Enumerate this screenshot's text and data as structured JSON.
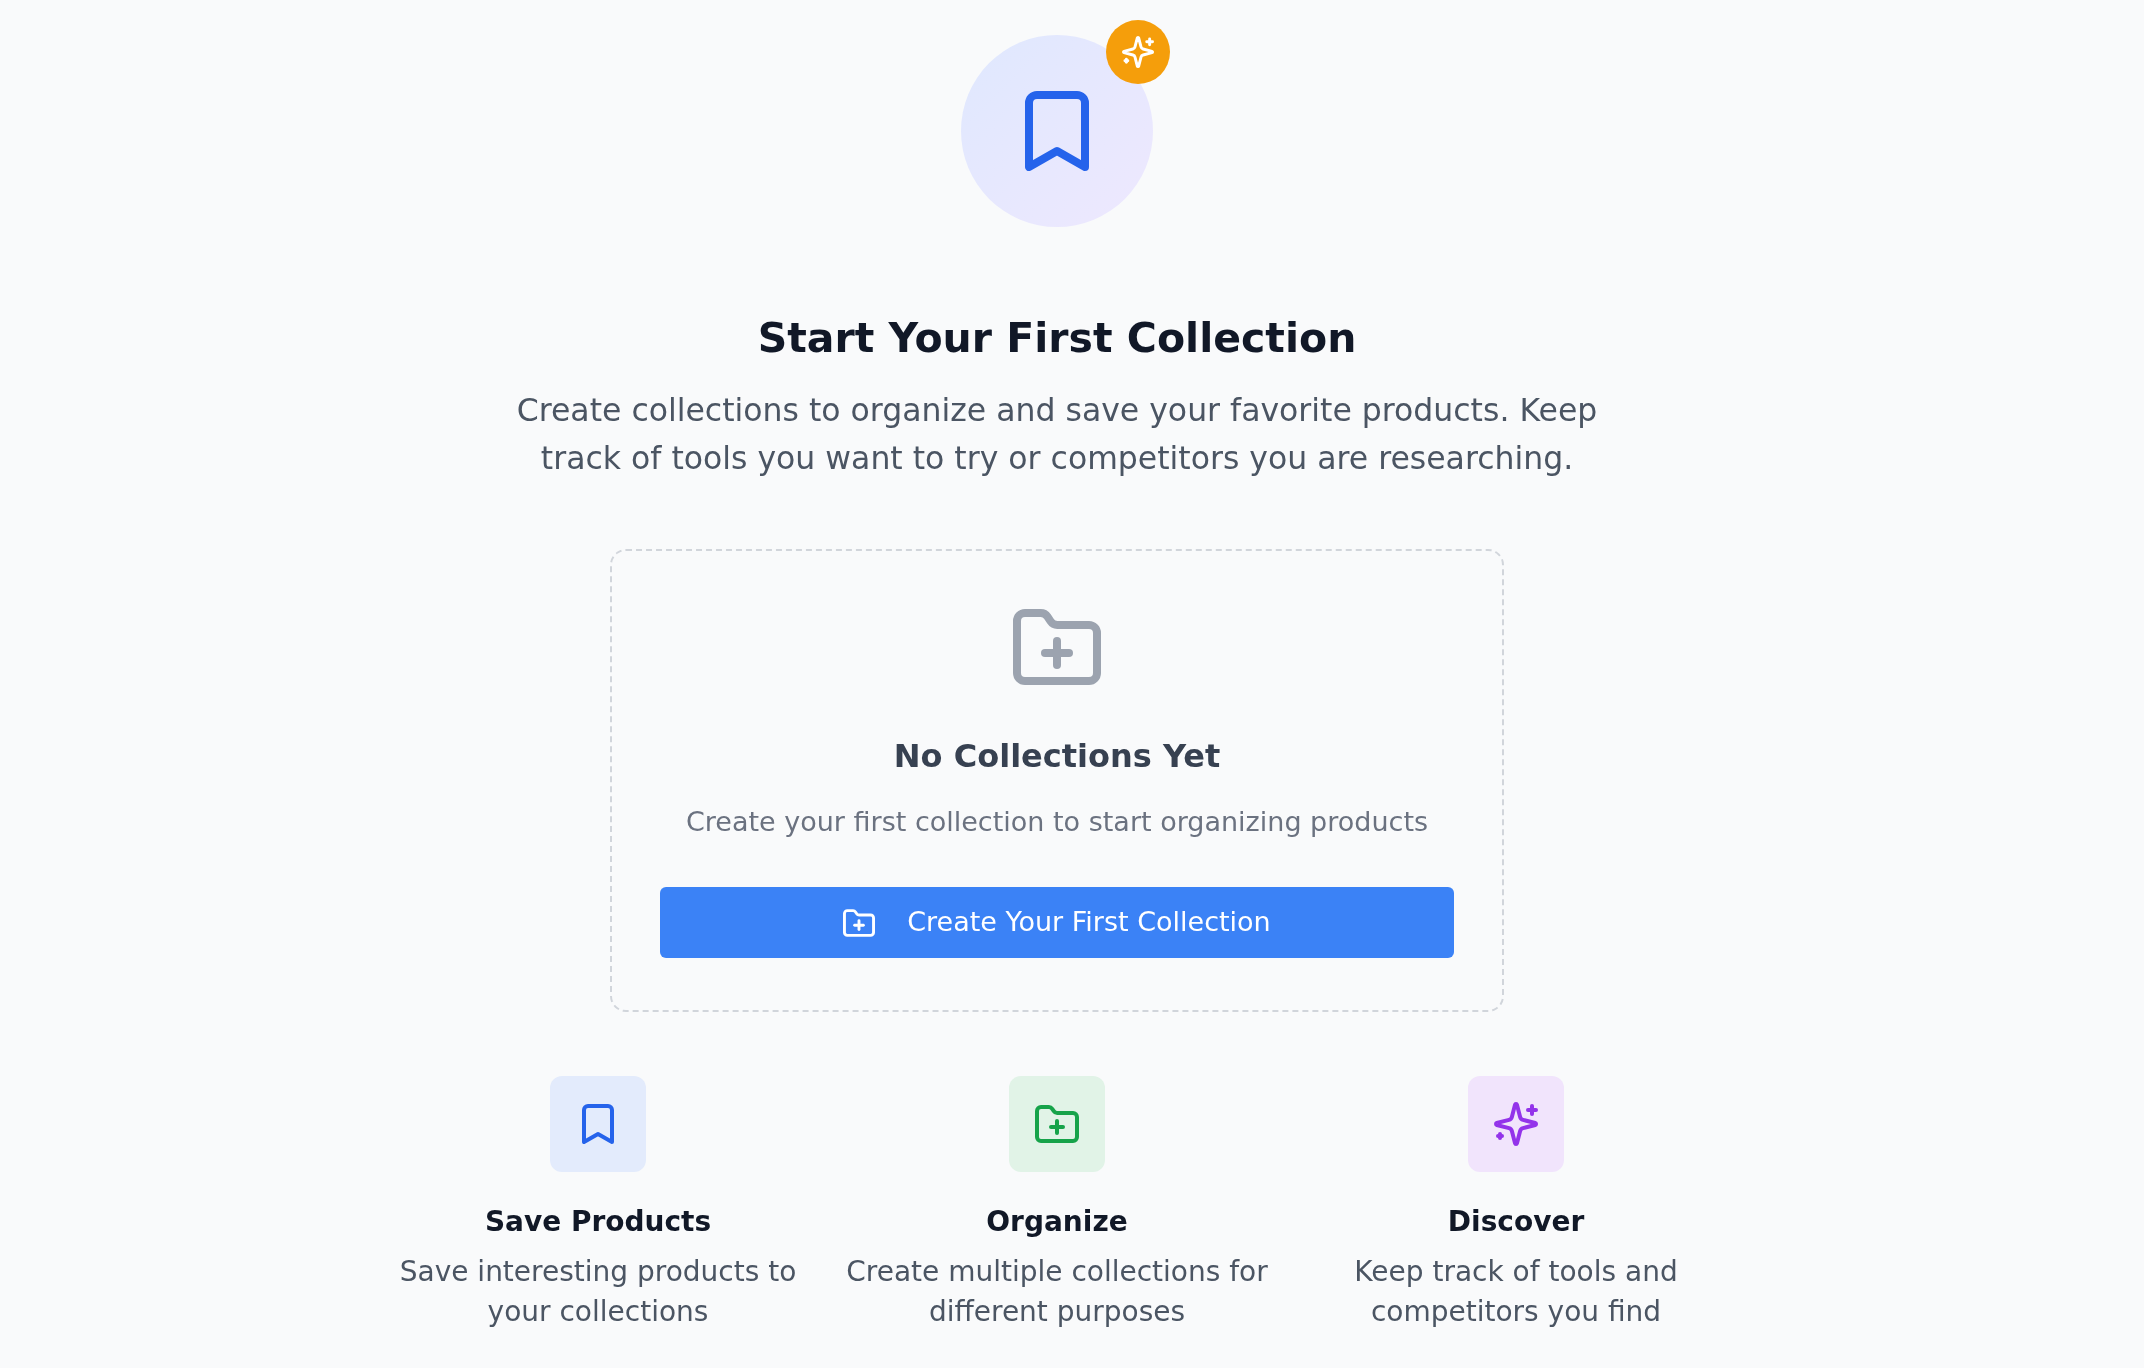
{
  "heading": "Start Your First Collection",
  "intro": "Create collections to organize and save your favorite products. Keep track of tools you want to try or competitors you are researching.",
  "empty_state": {
    "title": "No Collections Yet",
    "message": "Create your first collection to start organizing products",
    "button": "Create Your First Collection"
  },
  "features": [
    {
      "title": "Save Products",
      "description": "Save interesting products to your collections",
      "color": "#2563eb"
    },
    {
      "title": "Organize",
      "description": "Create multiple collections for different purposes",
      "color": "#16a34a"
    },
    {
      "title": "Discover",
      "description": "Keep track of tools and competitors you find",
      "color": "#9333ea"
    }
  ]
}
